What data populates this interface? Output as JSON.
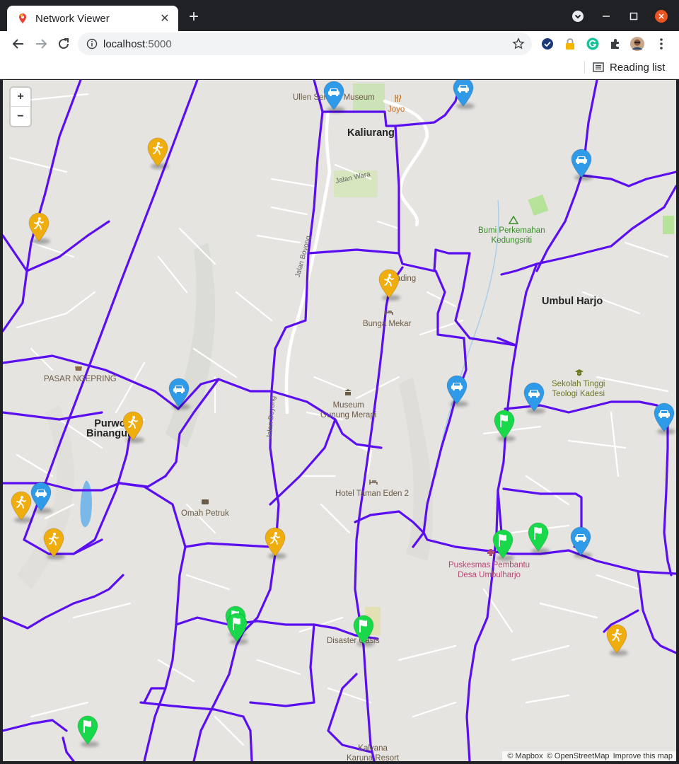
{
  "browser": {
    "tab_title": "Network Viewer",
    "url_host": "localhost",
    "url_port": ":5000",
    "reading_list_label": "Reading list"
  },
  "map": {
    "zoom_in_label": "+",
    "zoom_out_label": "−",
    "attribution": [
      "© Mapbox",
      "© OpenStreetMap",
      "Improve this map"
    ],
    "route_color": "#5b0ff0",
    "places": [
      {
        "id": "ullen",
        "text": "Ullen Sentalu Museum",
        "style": "brown"
      },
      {
        "id": "joyo",
        "text": "Joyo",
        "style": "orange"
      },
      {
        "id": "kaliurang",
        "text": "Kaliurang",
        "style": "town"
      },
      {
        "id": "jalan-wara",
        "text": "Jalan Wara",
        "style": "road"
      },
      {
        "id": "bumi",
        "text": "Bumi Perkemahan\nKedungsriti",
        "style": "green"
      },
      {
        "id": "umbul",
        "text": "Umbul Harjo",
        "style": "town"
      },
      {
        "id": "reading",
        "text": "ading",
        "style": "brown"
      },
      {
        "id": "bunga",
        "text": "Bunga Mekar",
        "style": "brown"
      },
      {
        "id": "pasar",
        "text": "PASAR NGEPRING",
        "style": "brown"
      },
      {
        "id": "sekolah",
        "text": "Sekolah Tinggi\nTeologi Kadesi",
        "style": "olive"
      },
      {
        "id": "museum",
        "text": "Museum\nGunung Merapi",
        "style": "brown"
      },
      {
        "id": "purwo",
        "text": "Purwo\nBinangun",
        "style": "town"
      },
      {
        "id": "jalan-boyong1",
        "text": "Jalan Boyong",
        "style": "road"
      },
      {
        "id": "jalan-boyong2",
        "text": "Jalan Boyong",
        "style": "road"
      },
      {
        "id": "hotel",
        "text": "Hotel Taman Eden 2",
        "style": "brown"
      },
      {
        "id": "omah",
        "text": "Omah Petruk",
        "style": "brown"
      },
      {
        "id": "puskesmas",
        "text": "Puskesmas Pembantu\nDesa Umbulharjo",
        "style": "pink"
      },
      {
        "id": "disaster",
        "text": "Disaster Oasis",
        "style": "brown"
      },
      {
        "id": "kalvana",
        "text": "Kalvana\nKaruna Resort",
        "style": "brown"
      }
    ],
    "marker_colors": {
      "car": "#2f9ae8",
      "walk": "#f0ad0e",
      "flag": "#19d94a"
    },
    "markers": [
      {
        "kind": "car",
        "icon": "car-icon"
      },
      {
        "kind": "car",
        "icon": "car-icon"
      },
      {
        "kind": "walk",
        "icon": "pedestrian-icon"
      },
      {
        "kind": "car",
        "icon": "car-icon"
      },
      {
        "kind": "walk",
        "icon": "pedestrian-icon"
      },
      {
        "kind": "walk",
        "icon": "pedestrian-icon"
      },
      {
        "kind": "car",
        "icon": "car-icon"
      },
      {
        "kind": "car",
        "icon": "car-icon"
      },
      {
        "kind": "car",
        "icon": "car-icon"
      },
      {
        "kind": "car",
        "icon": "car-icon"
      },
      {
        "kind": "flag",
        "icon": "flag-icon"
      },
      {
        "kind": "walk",
        "icon": "pedestrian-icon"
      },
      {
        "kind": "car",
        "icon": "car-icon"
      },
      {
        "kind": "walk",
        "icon": "pedestrian-icon"
      },
      {
        "kind": "walk",
        "icon": "pedestrian-icon"
      },
      {
        "kind": "walk",
        "icon": "pedestrian-icon"
      },
      {
        "kind": "flag",
        "icon": "flag-icon"
      },
      {
        "kind": "flag",
        "icon": "flag-icon"
      },
      {
        "kind": "car",
        "icon": "car-icon"
      },
      {
        "kind": "flag",
        "icon": "flag-icon"
      },
      {
        "kind": "flag",
        "icon": "flag-icon"
      },
      {
        "kind": "flag",
        "icon": "flag-icon"
      },
      {
        "kind": "walk",
        "icon": "pedestrian-icon"
      },
      {
        "kind": "flag",
        "icon": "flag-icon"
      }
    ]
  }
}
